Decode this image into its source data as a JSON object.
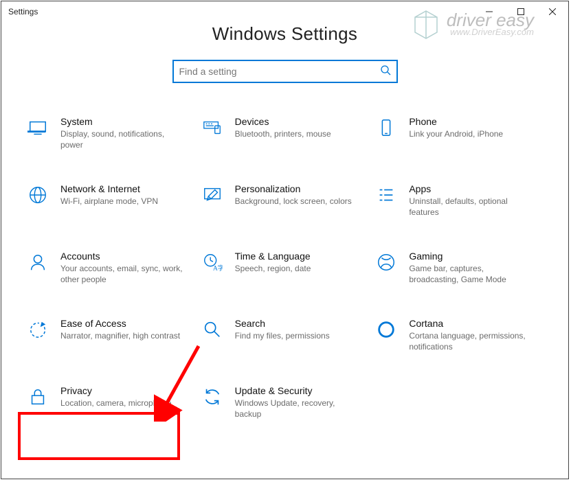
{
  "window": {
    "title": "Settings"
  },
  "page": {
    "heading": "Windows Settings"
  },
  "search": {
    "placeholder": "Find a setting"
  },
  "watermark": {
    "main": "driver easy",
    "sub": "www.DriverEasy.com"
  },
  "tiles": [
    {
      "id": "system",
      "title": "System",
      "desc": "Display, sound, notifications, power"
    },
    {
      "id": "devices",
      "title": "Devices",
      "desc": "Bluetooth, printers, mouse"
    },
    {
      "id": "phone",
      "title": "Phone",
      "desc": "Link your Android, iPhone"
    },
    {
      "id": "network",
      "title": "Network & Internet",
      "desc": "Wi-Fi, airplane mode, VPN"
    },
    {
      "id": "personalization",
      "title": "Personalization",
      "desc": "Background, lock screen, colors"
    },
    {
      "id": "apps",
      "title": "Apps",
      "desc": "Uninstall, defaults, optional features"
    },
    {
      "id": "accounts",
      "title": "Accounts",
      "desc": "Your accounts, email, sync, work, other people"
    },
    {
      "id": "time",
      "title": "Time & Language",
      "desc": "Speech, region, date"
    },
    {
      "id": "gaming",
      "title": "Gaming",
      "desc": "Game bar, captures, broadcasting, Game Mode"
    },
    {
      "id": "ease",
      "title": "Ease of Access",
      "desc": "Narrator, magnifier, high contrast"
    },
    {
      "id": "searchcat",
      "title": "Search",
      "desc": "Find my files, permissions"
    },
    {
      "id": "cortana",
      "title": "Cortana",
      "desc": "Cortana language, permissions, notifications"
    },
    {
      "id": "privacy",
      "title": "Privacy",
      "desc": "Location, camera, microphone"
    },
    {
      "id": "update",
      "title": "Update & Security",
      "desc": "Windows Update, recovery, backup"
    }
  ]
}
